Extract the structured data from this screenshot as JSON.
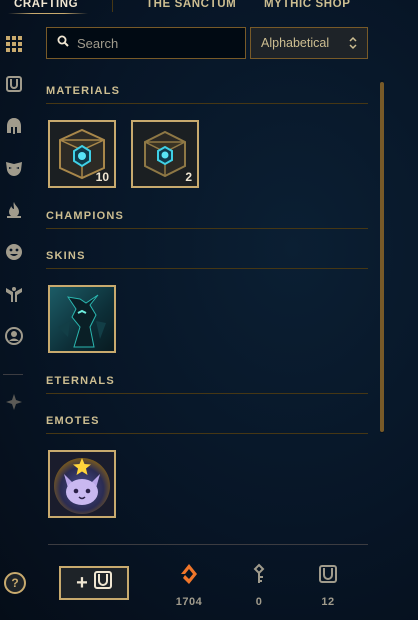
{
  "nav": {
    "tabs": [
      {
        "label": "CRAFTING",
        "active": true
      },
      {
        "label": "THE SANCTUM",
        "active": false
      },
      {
        "label": "MYTHIC SHOP",
        "active": false
      }
    ]
  },
  "rail": {
    "icons": [
      "grid-icon",
      "chest-icon",
      "champion-helmet-icon",
      "skin-mask-icon",
      "ward-flame-icon",
      "emote-face-icon",
      "summoner-icon-wings",
      "profile-icon",
      "eternals-icon"
    ],
    "help_label": "?"
  },
  "search": {
    "placeholder": "Search",
    "value": ""
  },
  "sort": {
    "selected": "Alphabetical"
  },
  "sections": [
    {
      "title": "MATERIALS",
      "items": [
        {
          "name": "Hextech Chest",
          "count": "10"
        },
        {
          "name": "Masterwork Chest",
          "count": "2"
        }
      ]
    },
    {
      "title": "CHAMPIONS",
      "items": []
    },
    {
      "title": "SKINS",
      "items": [
        {
          "name": "Skin shard"
        }
      ]
    },
    {
      "title": "ETERNALS",
      "items": []
    },
    {
      "title": "EMOTES",
      "items": [
        {
          "name": "Bunny emote"
        }
      ]
    }
  ],
  "footer": {
    "add_label": "+",
    "currencies": [
      {
        "icon": "orange-essence-icon",
        "value": "1704"
      },
      {
        "icon": "key-icon",
        "value": "0"
      },
      {
        "icon": "chest-icon",
        "value": "12"
      }
    ]
  },
  "colors": {
    "gold": "#c8aa6e",
    "gold_dark": "#785a28",
    "text": "#a09b8c",
    "bg": "#071526",
    "orange": "#f0762a"
  }
}
